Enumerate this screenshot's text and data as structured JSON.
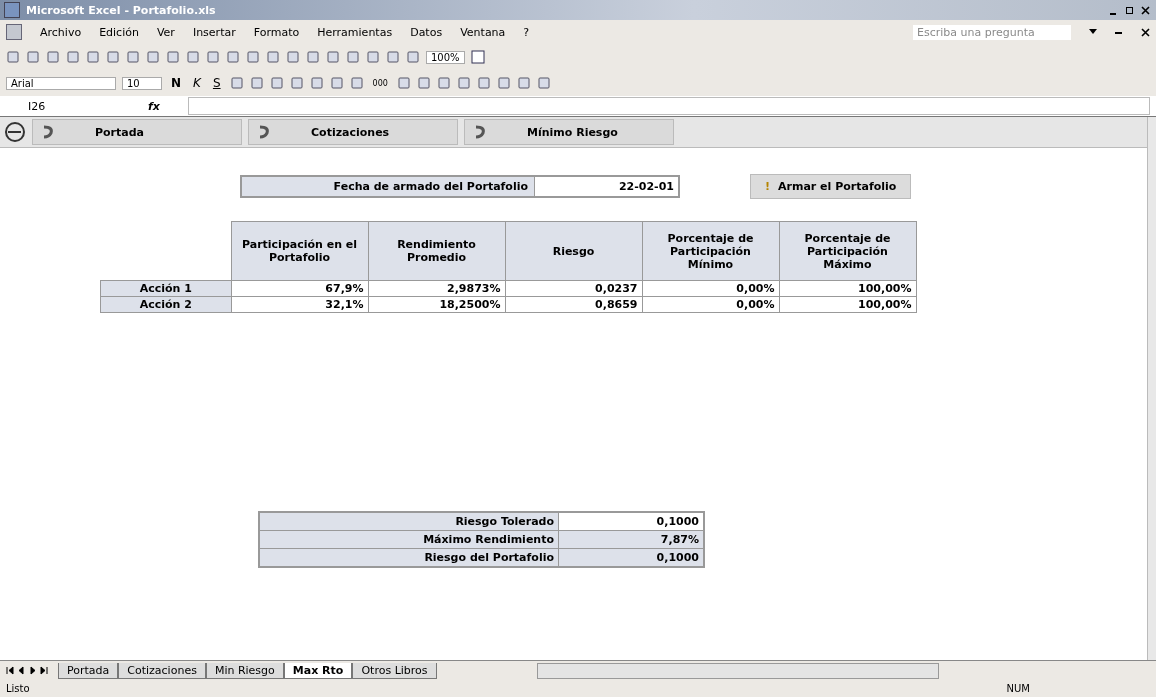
{
  "window": {
    "title": "Microsoft Excel - Portafolio.xls"
  },
  "menu": [
    "Archivo",
    "Edición",
    "Ver",
    "Insertar",
    "Formato",
    "Herramientas",
    "Datos",
    "Ventana",
    "?"
  ],
  "help_search": {
    "placeholder": "Escriba una pregunta"
  },
  "standard_toolbar": {
    "zoom": "100%"
  },
  "format_toolbar": {
    "font": "Arial",
    "size": "10",
    "bold": "N",
    "italic": "K",
    "underline": "S",
    "thousands": "000"
  },
  "formula_bar": {
    "cell": "I26",
    "fx": "fx"
  },
  "nav_buttons": [
    "Portada",
    "Cotizaciones",
    "Mínimo Riesgo"
  ],
  "date_row": {
    "label": "Fecha de armado del Portafolio",
    "value": "22-02-01"
  },
  "action_button": {
    "icon": "!",
    "label": "Armar el Portafolio"
  },
  "table": {
    "columns": [
      "Participación en el Portafolio",
      "Rendimiento Promedio",
      "Riesgo",
      "Porcentaje de Participación Mínimo",
      "Porcentaje de Participación Máximo"
    ],
    "rows": [
      {
        "label": "Acción 1",
        "cells": [
          "67,9%",
          "2,9873%",
          "0,0237",
          "0,00%",
          "100,00%"
        ]
      },
      {
        "label": "Acción 2",
        "cells": [
          "32,1%",
          "18,2500%",
          "0,8659",
          "0,00%",
          "100,00%"
        ]
      }
    ]
  },
  "summary": [
    {
      "label": "Riesgo Tolerado",
      "value": "0,1000",
      "editable": true
    },
    {
      "label": "Máximo Rendimiento",
      "value": "7,87%",
      "editable": false
    },
    {
      "label": "Riesgo del Portafolio",
      "value": "0,1000",
      "editable": false
    }
  ],
  "sheet_tabs": [
    {
      "label": "Portada",
      "selected": false
    },
    {
      "label": "Cotizaciones",
      "selected": false
    },
    {
      "label": "Min Riesgo",
      "selected": false
    },
    {
      "label": "Max Rto",
      "selected": true
    },
    {
      "label": "Otros Libros",
      "selected": false
    }
  ],
  "status_bar": {
    "left": "Listo",
    "right": "NUM"
  }
}
